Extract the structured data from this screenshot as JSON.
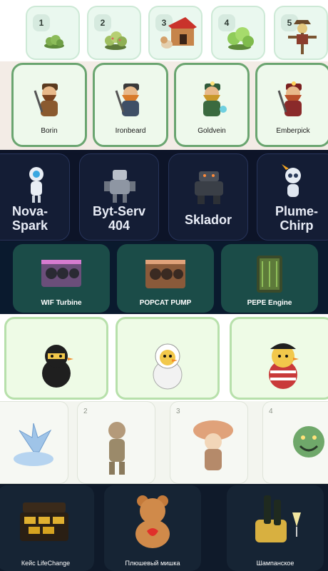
{
  "band1": {
    "cards": [
      {
        "num": "1",
        "icon": "bush-icon"
      },
      {
        "num": "2",
        "icon": "bush-icon"
      },
      {
        "num": "3",
        "icon": "doghouse-icon"
      },
      {
        "num": "4",
        "icon": "bush-icon"
      },
      {
        "num": "5",
        "icon": "scarecrow-icon"
      }
    ]
  },
  "band2": {
    "cards": [
      {
        "name": "Borin",
        "icon": "dwarf-miner-icon"
      },
      {
        "name": "Ironbeard",
        "icon": "dwarf-miner-icon"
      },
      {
        "name": "Goldvein",
        "icon": "dwarf-miner-icon"
      },
      {
        "name": "Emberpick",
        "icon": "dwarf-miner-icon"
      }
    ]
  },
  "band3": {
    "cards": [
      {
        "line1": "Nova-",
        "line2": "Spark",
        "icon": "robot-icon"
      },
      {
        "line1": "Byt-Serv",
        "line2": "404",
        "icon": "robot-icon"
      },
      {
        "line1": "Sklador",
        "line2": "",
        "icon": "robot-icon"
      },
      {
        "line1": "Plume-",
        "line2": "Chirp",
        "icon": "robot-icon"
      }
    ]
  },
  "band4": {
    "cards": [
      {
        "name": "WIF Turbine",
        "icon": "mining-rig-icon"
      },
      {
        "name": "POPCAT PUMP",
        "icon": "mining-rig-icon"
      },
      {
        "name": "PEPE Engine",
        "icon": "mining-rig-icon"
      }
    ]
  },
  "band5": {
    "cards": [
      {
        "icon": "ninja-duck-icon"
      },
      {
        "icon": "astronaut-duck-icon"
      },
      {
        "icon": "pirate-duck-icon"
      }
    ]
  },
  "band6": {
    "cards": [
      {
        "num": "",
        "icon": "crystal-flower-icon"
      },
      {
        "num": "2",
        "icon": "tree-creature-icon"
      },
      {
        "num": "3",
        "icon": "mushroom-creature-icon"
      },
      {
        "num": "4",
        "icon": "plant-monster-icon"
      }
    ]
  },
  "band7": {
    "cards": [
      {
        "name": "Кейс LifeChange",
        "icon": "gold-case-icon"
      },
      {
        "name": "Плюшевый мишка",
        "icon": "teddy-bear-icon"
      },
      {
        "name": "Шампанское",
        "icon": "champagne-icon"
      }
    ]
  },
  "colors": {
    "band1_card": "#eaf8ef",
    "band2_border": "#6aa570",
    "band3_bg": "#0d1428",
    "band4_card": "#1b4c48",
    "band5_card": "#eefbe6",
    "band7_bg": "#0f1a2a"
  }
}
